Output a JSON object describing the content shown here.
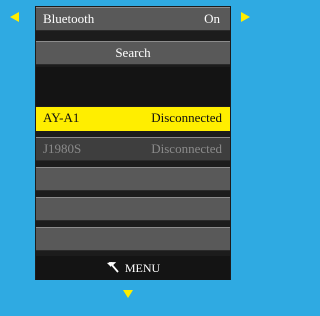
{
  "colors": {
    "background": "#2faae2",
    "arrow": "#ffee00",
    "selected_row": "#ffee00"
  },
  "nav": {
    "left_icon": "triangle-left-icon",
    "right_icon": "triangle-right-icon",
    "down_icon": "triangle-down-icon"
  },
  "bluetooth": {
    "label": "Bluetooth",
    "value": "On"
  },
  "search": {
    "label": "Search"
  },
  "devices": [
    {
      "name": "AY-A1",
      "status": "Disconnected",
      "selected": true
    },
    {
      "name": "J1980S",
      "status": "Disconnected",
      "selected": false
    }
  ],
  "footer": {
    "icon": "back-arrow-icon",
    "label": "MENU"
  }
}
